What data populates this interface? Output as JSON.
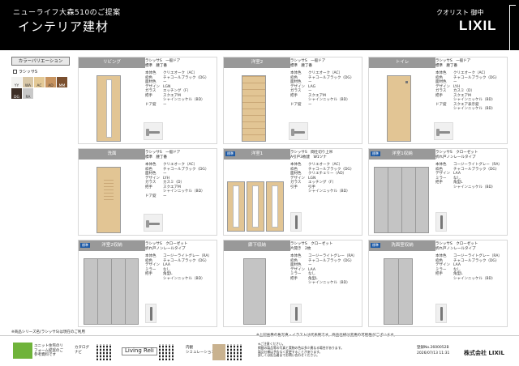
{
  "header": {
    "subtitle": "ニューライフ大森510のご提案",
    "title": "インテリア建材",
    "client": "クオリスト 御中",
    "logo": "LIXIL"
  },
  "left": {
    "variation_button": "カラーバリエーション",
    "option_label": "ラシッサS",
    "swatches": [
      {
        "code": "YY",
        "color": "#f3f3f1"
      },
      {
        "code": "WA",
        "color": "#d9c8a8"
      },
      {
        "code": "AC",
        "color": "#e4c996"
      },
      {
        "code": "AD",
        "color": "#c89460"
      },
      {
        "code": "MM",
        "color": "#7a4f2e"
      },
      {
        "code": "DG",
        "color": "#3d2e26"
      },
      {
        "code": "RA",
        "color": "#c9c9c9"
      }
    ],
    "note": "※商品シリーズ名(ラシッサS)は現在のご利用"
  },
  "cards": [
    {
      "title": "リビング",
      "name": "ラシッサS　一般ドア\n標準　腰丁番",
      "spec": [
        [
          "本体色",
          "クリエオーク（AC）"
        ],
        [
          "枠色",
          "チャコールブラック（DG）"
        ],
        [
          "面材色",
          "ー"
        ],
        [
          "デザイン",
          "LGN"
        ],
        [
          "ガラス",
          "エッチング（F）"
        ],
        [
          "把手",
          "スクエアM"
        ],
        [
          "",
          "シャインニッケル（BD）"
        ],
        [
          "ドア錠",
          "ー"
        ]
      ]
    },
    {
      "title": "洋室2",
      "name": "ラシッサS　一般ドア\n標準　腰丁番",
      "spec": [
        [
          "本体色",
          "クリエオーク（AC）"
        ],
        [
          "枠色",
          "チャコールブラック（DG）"
        ],
        [
          "面材色",
          "ー"
        ],
        [
          "デザイン",
          "LAG"
        ],
        [
          "ガラス",
          "ー"
        ],
        [
          "把手",
          "スクエアM"
        ],
        [
          "",
          "シャインニッケル（BD）"
        ],
        [
          "ドア錠",
          "ー"
        ]
      ]
    },
    {
      "title": "トイレ",
      "name": "ラシッサS　一般ドア\n標準　腰丁番",
      "spec": [
        [
          "本体色",
          "クリエオーク（AC）"
        ],
        [
          "枠色",
          "チャコールブラック（DG）"
        ],
        [
          "面材色",
          "ー"
        ],
        [
          "デザイン",
          "LYH"
        ],
        [
          "ガラス",
          "カスミ（D）"
        ],
        [
          "把手",
          "スクエアM"
        ],
        [
          "",
          "シャインニッケル（BD）"
        ],
        [
          "ドア錠",
          "スクエア表示錠"
        ],
        [
          "",
          "シャインニッケル（BD）"
        ]
      ]
    },
    {
      "title": "洗面",
      "name": "ラシッサS　一般ドア\n標準　腰丁番",
      "spec": [
        [
          "本体色",
          "クリエオーク（AC）"
        ],
        [
          "枠色",
          "チャコールブラック（DG）"
        ],
        [
          "面材色",
          "ー"
        ],
        [
          "デザイン",
          "LYH"
        ],
        [
          "ガラス",
          "カスミ（D）"
        ],
        [
          "把手",
          "スクエアM"
        ],
        [
          "",
          "シャインニッケル（BD）"
        ],
        [
          "ドア錠",
          "ー"
        ]
      ]
    },
    {
      "title": "洋室1",
      "badge": "標準",
      "name": "ラシッサS　間仕切り上吊\nA引戸3枚建　W1ツナ",
      "spec": [
        [
          "本体色",
          "クリエオーク（AC）"
        ],
        [
          "枠色",
          "チャコールブラック（DG）"
        ],
        [
          "面材色",
          "クリエチェリー（AD）"
        ],
        [
          "デザイン",
          "LGN"
        ],
        [
          "ガラス",
          "エッチング（F）"
        ],
        [
          "引手",
          "引手"
        ],
        [
          "",
          "シャインニッケル（BD）"
        ]
      ]
    },
    {
      "title": "洋室1収納",
      "badge": "標準",
      "name": "ラシッサS　クローゼット\n折れ戸ノンレールタイプ",
      "spec": [
        [
          "本体色",
          "コージーライトグレー（RA）"
        ],
        [
          "枠色",
          "チャコールブラック（DG）"
        ],
        [
          "デザイン",
          "LAA"
        ],
        [
          "ミラー",
          "なし"
        ],
        [
          "把手",
          "角型L"
        ],
        [
          "",
          "シャインニッケル（BD）"
        ]
      ]
    },
    {
      "title": "洋室2収納",
      "badge": "標準",
      "name": "ラシッサS　クローゼット\n折れ戸ノンレールタイプ",
      "spec": [
        [
          "本体色",
          "コージーライトグレー（RA）"
        ],
        [
          "枠色",
          "チャコールブラック（DG）"
        ],
        [
          "デザイン",
          "LAA"
        ],
        [
          "ミラー",
          "なし"
        ],
        [
          "把手",
          "角型L"
        ],
        [
          "",
          "シャインニッケル（BD）"
        ]
      ]
    },
    {
      "title": "廊下収納",
      "name": "ラシッサS　クローゼット\n片開き　2枚",
      "spec": [
        [
          "本体色",
          "コージーライトグレー（RA）"
        ],
        [
          "枠色",
          "チャコールブラック（DG）"
        ],
        [
          "面材色",
          "ー"
        ],
        [
          "デザイン",
          "LAA"
        ],
        [
          "ミラー",
          "なし"
        ],
        [
          "把手",
          "角型L"
        ],
        [
          "",
          "シャインニッケル（BD）"
        ]
      ]
    },
    {
      "title": "洗面室収納",
      "badge": "標準",
      "name": "ラシッサS　クローゼット\n折れ戸ノンレールタイプ",
      "spec": [
        [
          "本体色",
          "コージーライトグレー（RA）"
        ],
        [
          "枠色",
          "チャコールブラック（DG）"
        ],
        [
          "デザイン",
          "LAA"
        ],
        [
          "ミラー",
          "なし"
        ],
        [
          "把手",
          "角型L"
        ],
        [
          "",
          "シャインニッケル（BD）"
        ]
      ]
    }
  ],
  "footer": {
    "note": "※上記画像の色写真・イラストは代表例です。商品仕様は変更の可能性がございます。",
    "col1": "ユニット住宅のリフォーム提案のご参考資料です",
    "col2_top": "カタログ",
    "col2_mid": "ナビ",
    "col3": "Living Reli",
    "col4_top": "内観",
    "col4_mid": "シミュレーション",
    "disclaimer": "※ご注意ください。\n掲載の製品等の写真と実物の色は多少異なる場合があります。\n製品仕様は予告なく変更することがあります。\n詳しくは担当者までお問い合わせください。",
    "doc_no": "登録No.2600052B",
    "date": "2026/07/13 11:31",
    "company": "株式会社 LIXIL"
  }
}
